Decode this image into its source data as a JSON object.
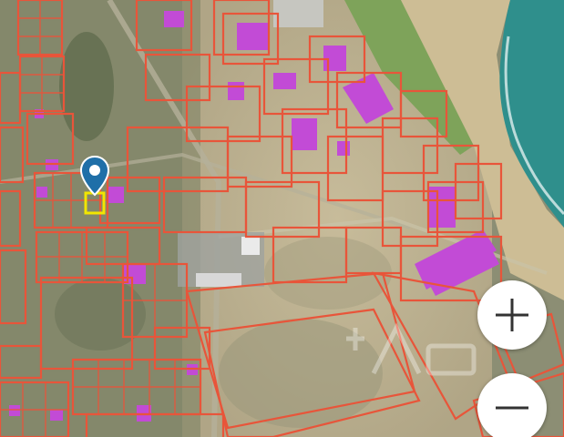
{
  "map": {
    "view": "satellite-cadastral",
    "colors": {
      "parcel_outline": "#e8553a",
      "selected_parcel": "#f2e600",
      "building_fill": "#c24bd6",
      "sea": "#2f8f8c",
      "field": "#7ea35a",
      "sand": "#c8b592",
      "pin": "#1f6fa8"
    }
  },
  "controls": {
    "zoom_in_icon": "plus-icon",
    "zoom_out_icon": "minus-icon"
  },
  "marker": {
    "icon": "map-pin-icon"
  },
  "watermark": {
    "icon": "cian-logo-icon"
  }
}
